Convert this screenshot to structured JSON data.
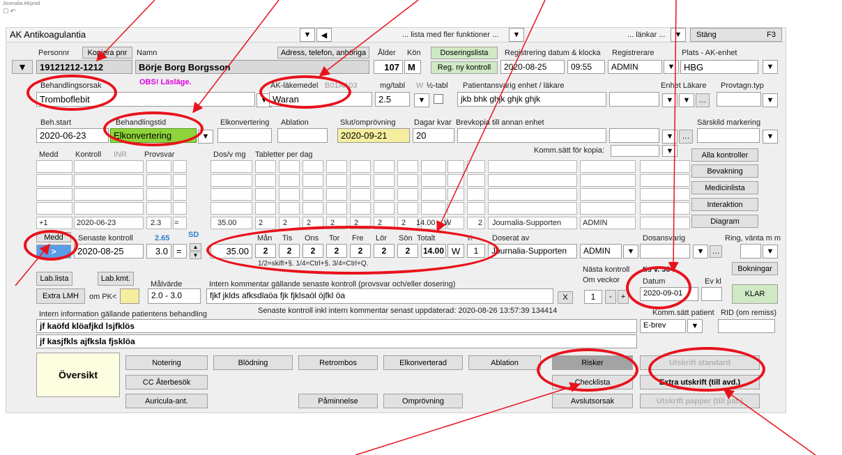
{
  "window": {
    "app_name": "Journalia AKprod",
    "title": "AK Antikoagulantia"
  },
  "topbar": {
    "more_functions": "... lista med fler funktioner ...",
    "links": "... länkar ...",
    "close": "Stäng",
    "close_key": "F3"
  },
  "patient": {
    "personnr_label": "Personnr",
    "personnr": "19121212-1212",
    "copy_pnr": "Kopiera pnr",
    "name_label": "Namn",
    "name": "Börje Borg Borgsson",
    "address_button": "Adress, telefon, anhöriga",
    "age_label": "Ålder",
    "age": "107",
    "sex_label": "Kön",
    "sex": "M",
    "dosing_list": "Doseringslista",
    "reg_new": "Reg. ny kontroll",
    "reg_label": "Registrering datum & klocka",
    "reg_date": "2020-08-25",
    "reg_time": "09:55",
    "registrar_label": "Registrerare",
    "registrar": "ADMIN",
    "place_label": "Plats - AK-enhet",
    "place": "HBG"
  },
  "treatment": {
    "reason_label": "Behandlingsorsak",
    "reason": "Tromboflebit",
    "warning": "OBS! Läsläge.",
    "drug_label": "AK-läkemedel",
    "drug_code": "B01AA03",
    "drug": "Waran",
    "mg_label": "mg/tabl",
    "mg": "2.5",
    "w_label": "W",
    "half_label": "½-tabl",
    "responsible_label": "Patientansvarig enhet / läkare",
    "responsible": "jkb bhk ghjk ghjk ghjk",
    "unit_doctor_label": "Enhet Läkare",
    "sample_type_label": "Provtagn.typ",
    "start_label": "Beh.start",
    "start": "2020-06-23",
    "duration_label": "Behandlingstid",
    "duration": "Elkonvertering",
    "elkonv_label": "Elkonvertering",
    "ablation_label": "Ablation",
    "end_label": "Slut/omprövning",
    "end": "2020-09-21",
    "days_label": "Dagar kvar",
    "days": "20",
    "copy_label": "Brevkopia till annan enhet",
    "special_label": "Särskild markering",
    "comm_label": "Komm.sätt för kopia:"
  },
  "history": {
    "h_medd": "Medd",
    "h_kontroll": "Kontroll",
    "h_inr": "INR",
    "h_provsvar": "Provsvar",
    "h_dos": "Dos/v mg",
    "h_tabl": "Tabletter per dag",
    "row": {
      "medd": "+1",
      "date": "2020-06-23",
      "value": "2.3",
      "eq": "=",
      "dos": "35.00",
      "d1": "2",
      "d2": "2",
      "d3": "2",
      "d4": "2",
      "d5": "2",
      "d6": "2",
      "d7": "2",
      "total": "14.00",
      "w": "W",
      "n": "2",
      "by": "Journalia-Supporten",
      "resp": "ADMIN"
    }
  },
  "current": {
    "medd_label": "Medd",
    "latest_label": "Senaste kontroll",
    "inr": "2.65",
    "sd": "SD",
    "medd_btn": ">",
    "date": "2020-08-25",
    "value": "3.0",
    "eq": "=",
    "dos": "35.00",
    "days": {
      "mon": "Mån",
      "tue": "Tis",
      "wed": "Ons",
      "thu": "Tor",
      "fri": "Fre",
      "sat": "Lör",
      "sun": "Sön",
      "total": "Totalt"
    },
    "vals": {
      "mon": "2",
      "tue": "2",
      "wed": "2",
      "thu": "2",
      "fri": "2",
      "sat": "2",
      "sun": "2",
      "total": "14.00"
    },
    "w": "W",
    "vi": "vi",
    "n": "1",
    "dosed_by_label": "Doserat av",
    "dosed_by": "Journalia-Supporten",
    "resp": "ADMIN",
    "dose_resp_label": "Dosansvarig",
    "ring_label": "Ring, vänta m m",
    "hint": "1/2=skift+§. 1/4=Ctrl+§. 3/4=Ctrl+Q."
  },
  "next": {
    "label": "Nästa kontroll",
    "weekday": "tis v. 36",
    "weeks_label": "Om veckor",
    "weeks": "1",
    "minus": "-",
    "plus": "+",
    "date_label": "Datum",
    "date": "2020-09-01",
    "time_label": "Ev kl",
    "ready": "KLAR"
  },
  "lab": {
    "list": "Lab.lista",
    "comment": "Lab.kmt.",
    "extra": "Extra LMH",
    "om_pk": "om PK<",
    "target_label": "Målvärde",
    "target": "2.0 - 3.0",
    "internal_label": "Intern kommentar gällande senaste kontroll (provsvar och/eller dosering)",
    "internal": "fjkf jklds afksdlaöa fjk fjklsaöl öjfkl öa",
    "clear": "X",
    "updated": "Senaste kontroll inkl intern kommentar senast uppdaterad:  2020-08-26 13:57:39  134414",
    "info_label": "Intern information gällande patientens behandling",
    "info1": "jf kaöfd klöafjkd lsjfklös",
    "info2": "jf kasjfkls ajfksla fjsklöa",
    "comm_patient_label": "Komm.sätt patient",
    "comm_patient": "E-brev",
    "rid_label": "RID (om remiss)"
  },
  "side": {
    "all": "Alla kontroller",
    "watch": "Bevakning",
    "meds": "Medicinlista",
    "interaction": "Interaktion",
    "diagram": "Diagram",
    "booking": "Bokningar"
  },
  "bottom": {
    "overview": "Översikt",
    "notering": "Notering",
    "blodning": "Blödning",
    "retrombos": "Retrombos",
    "elkonverterad": "Elkonverterad",
    "ablation": "Ablation",
    "risker": "Risker",
    "cc": "CC Återbesök",
    "checklista": "Checklista",
    "auricula": "Auricula-ant.",
    "paminnelse": "Påminnelse",
    "omprovning": "Omprövning",
    "avslutsorsak": "Avslutsorsak",
    "print_standard": "Utskrift standard",
    "print_extra": "Extra utskrift (till avd.)",
    "print_paper": "Utskrift papper (till pat.)"
  },
  "colors": {
    "annotation": "#e8121b",
    "highlight_green": "#8ed43a",
    "highlight_yellow": "#f6ee9f"
  }
}
